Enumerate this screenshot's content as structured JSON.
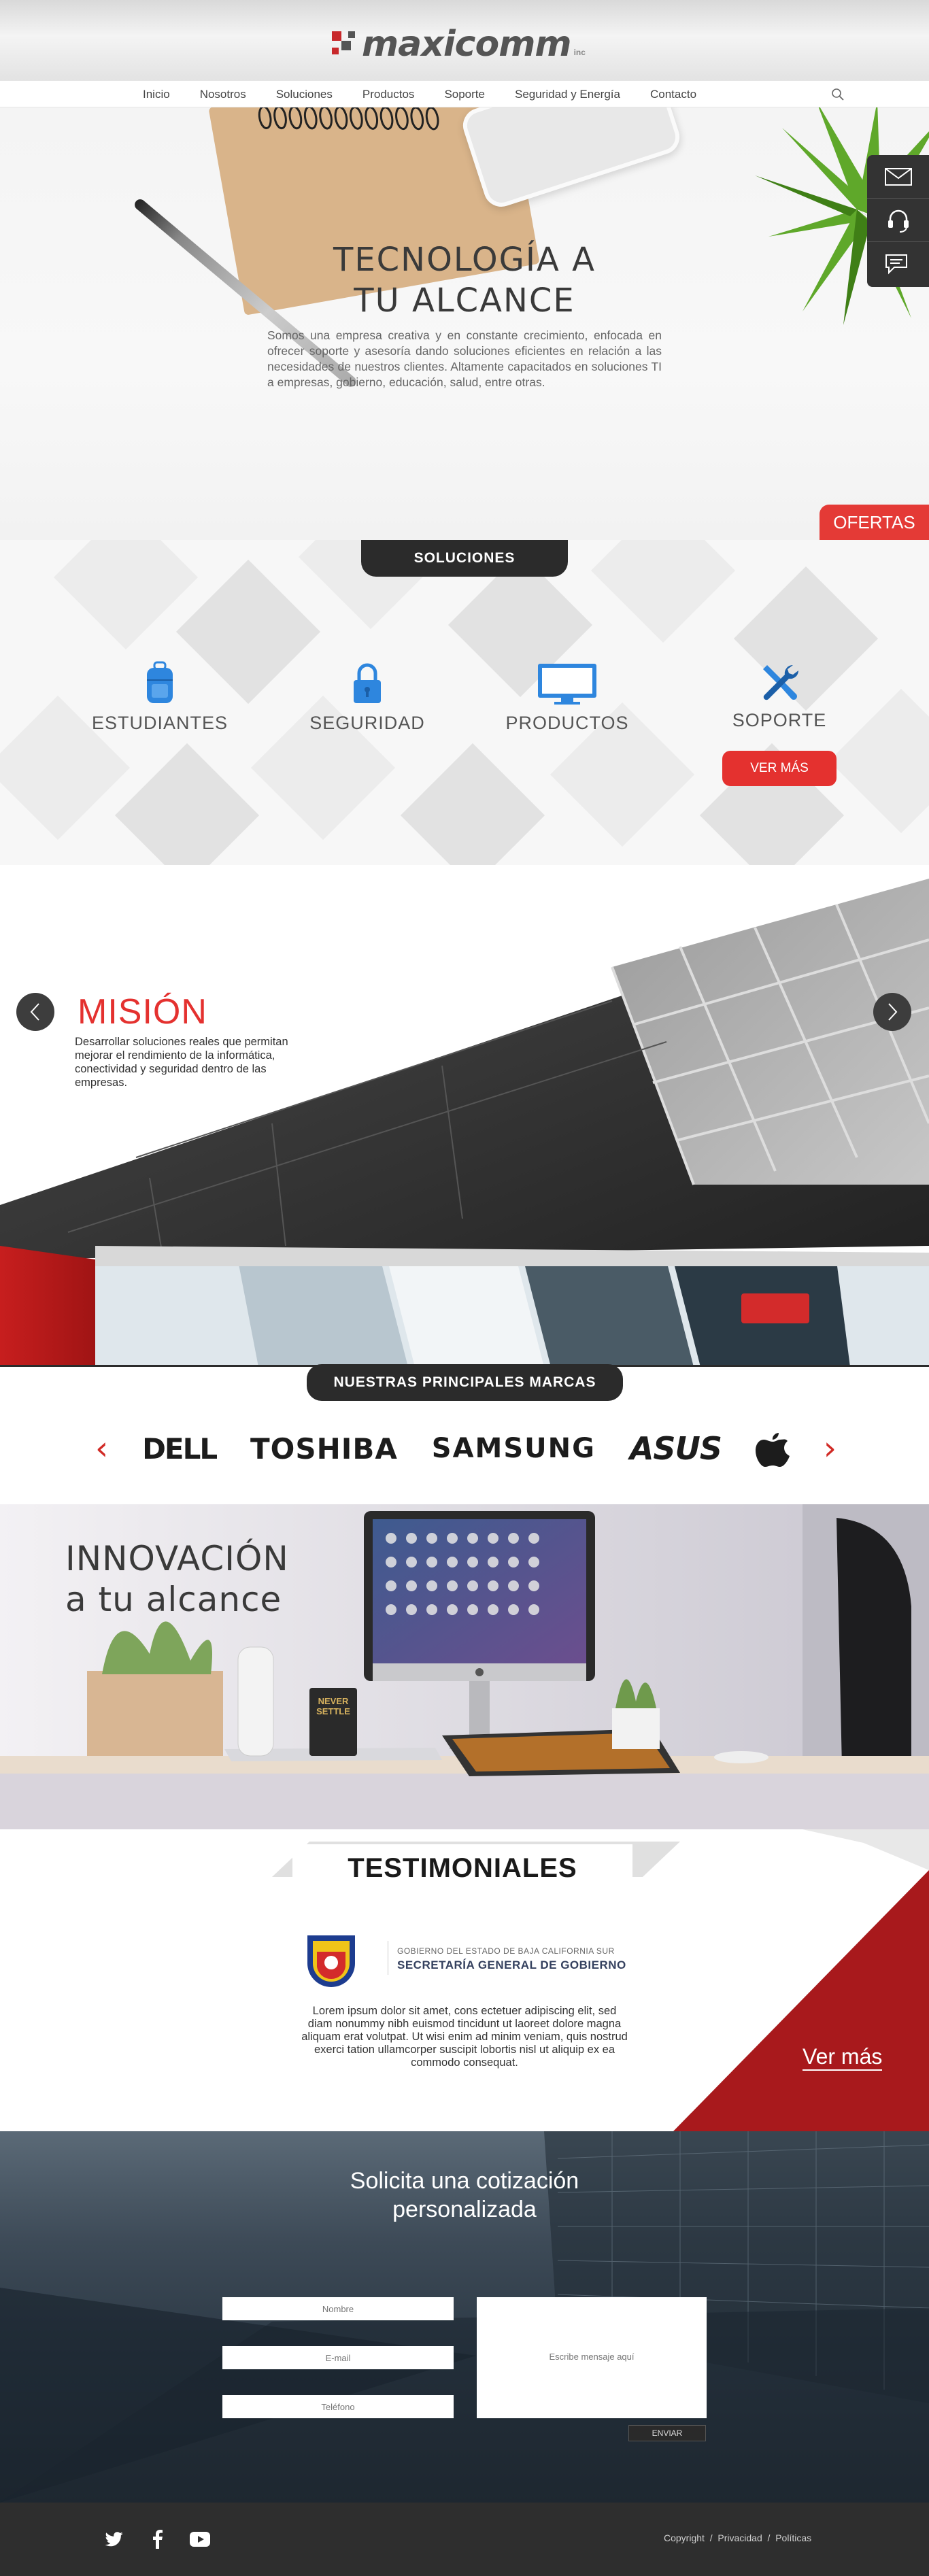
{
  "header": {
    "logo_text": "maxicomm",
    "logo_tm": "inc",
    "nav": [
      "Inicio",
      "Nosotros",
      "Soluciones",
      "Productos",
      "Soporte",
      "Seguridad y Energía",
      "Contacto"
    ]
  },
  "hero": {
    "title_line1": "TECNOLOGÍA A",
    "title_line2": "TU ALCANCE",
    "text": "Somos una empresa creativa y en constante crecimiento, enfocada en ofrecer soporte y asesoría dando soluciones eficientes en relación a las necesidades de nuestros clientes. Altamente capacitados en soluciones TI a empresas, gobierno, educación, salud, entre otras.",
    "ofertas": "OFERTAS"
  },
  "soluciones": {
    "pill": "SOLUCIONES",
    "items": [
      "ESTUDIANTES",
      "SEGURIDAD",
      "PRODUCTOS",
      "SOPORTE"
    ],
    "ver_mas": "VER MÁS"
  },
  "mision": {
    "title": "MISIÓN",
    "text": "Desarrollar soluciones reales que permitan mejorar el rendimiento de la informática, conectividad y seguridad dentro de las empresas."
  },
  "marcas": {
    "pill": "NUESTRAS PRINCIPALES MARCAS",
    "brands": [
      "DELL",
      "TOSHIBA",
      "SAMSUNG",
      "ASUS"
    ]
  },
  "innovacion": {
    "line1": "INNOVACIÓN",
    "line2": "a tu alcance",
    "screen_label": "NEVER SETTLE"
  },
  "testimoniales": {
    "title": "TESTIMONIALES",
    "org_line1": "GOBIERNO DEL ESTADO DE BAJA CALIFORNIA SUR",
    "org_line2": "SECRETARÍA GENERAL DE GOBIERNO",
    "text": "Lorem ipsum dolor sit amet, cons ectetuer adipiscing elit, sed diam nonummy nibh euismod tincidunt ut laoreet dolore magna aliquam erat volutpat. Ut wisi enim ad minim veniam, quis nostrud exerci tation ullamcorper suscipit lobortis nisl ut aliquip ex ea commodo consequat.",
    "ver_mas": "Ver más"
  },
  "cotizacion": {
    "title_line1": "Solicita una cotización",
    "title_line2": "personalizada",
    "nombre_placeholder": "Nombre",
    "email_placeholder": "E-mail",
    "telefono_placeholder": "Teléfono",
    "mensaje_placeholder": "Escribe mensaje aquí",
    "enviar": "ENVIAR"
  },
  "footer": {
    "copyright": "Copyright",
    "privacidad": "Privacidad",
    "politicas": "Políticas",
    "sep": "/"
  },
  "colors": {
    "accent_red": "#e4312f",
    "dark": "#2b2b2b",
    "footer": "#2e2e2e"
  }
}
